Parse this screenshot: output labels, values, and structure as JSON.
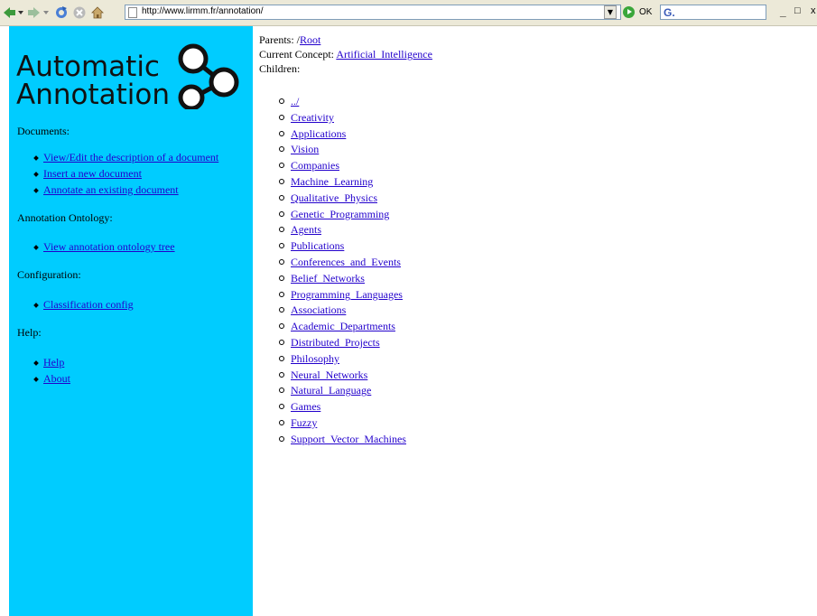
{
  "browser": {
    "address": "http://www.lirmm.fr/annotation/",
    "go_label": "OK",
    "search_glyph": "G.",
    "minimize": "_",
    "maximize": "□",
    "close": "x"
  },
  "logo": {
    "line1": "Automatic",
    "line2": "Annotation"
  },
  "sidebar": {
    "documents_heading": "Documents:",
    "documents": [
      "View/Edit the description of a document",
      "Insert a new document",
      "Annotate an existing document"
    ],
    "ontology_heading": "Annotation Ontology:",
    "ontology": [
      "View annotation ontology tree"
    ],
    "config_heading": "Configuration:",
    "config": [
      "Classification config"
    ],
    "help_heading": "Help:",
    "help": [
      "Help",
      "About"
    ]
  },
  "main": {
    "parents_label": "Parents: /",
    "parents_link": "Root",
    "current_label": "Current Concept: ",
    "current_link": "Artificial_Intelligence",
    "children_label": "Children:",
    "children": [
      "../",
      "Creativity",
      "Applications",
      "Vision",
      "Companies",
      "Machine_Learning",
      "Qualitative_Physics",
      "Genetic_Programming",
      "Agents",
      "Publications",
      "Conferences_and_Events",
      "Belief_Networks",
      "Programming_Languages",
      "Associations",
      "Academic_Departments",
      "Distributed_Projects",
      "Philosophy",
      "Neural_Networks",
      "Natural_Language",
      "Games",
      "Fuzzy",
      "Support_Vector_Machines"
    ]
  },
  "colors": {
    "sidebar_bg": "#00ccff",
    "link": "#2200cc",
    "toolbar_bg": "#ece9d8"
  }
}
